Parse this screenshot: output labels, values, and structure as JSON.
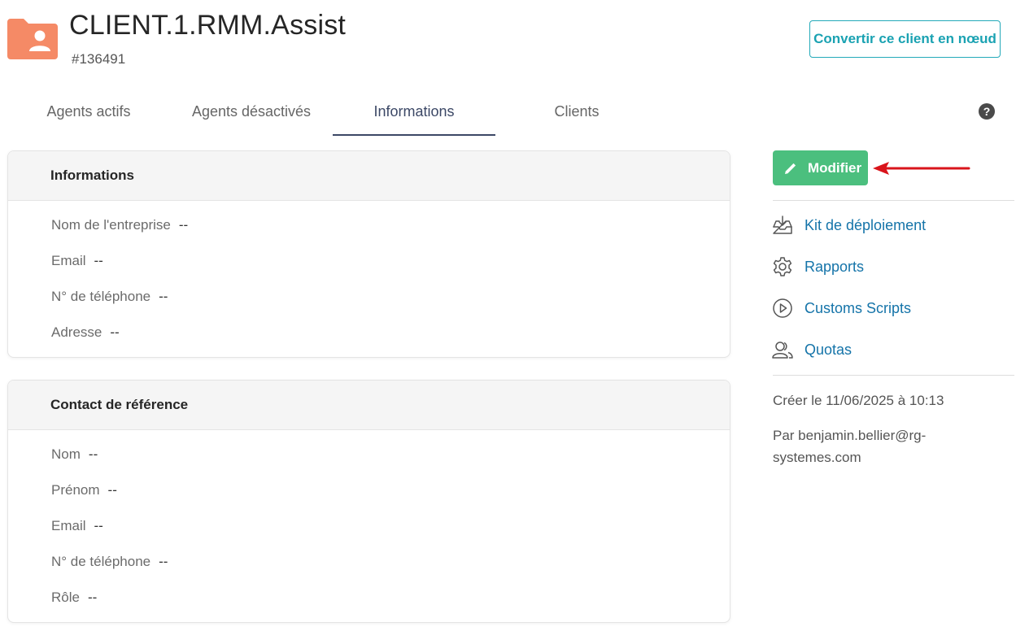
{
  "header": {
    "title": "CLIENT.1.RMM.Assist",
    "id": "#136491",
    "folder_color": "#f58a66",
    "convert_label": "Convertir ce client en nœud"
  },
  "tabs": [
    {
      "label": "Agents actifs"
    },
    {
      "label": "Agents désactivés"
    },
    {
      "label": "Informations"
    },
    {
      "label": "Clients"
    }
  ],
  "active_tab": "Informations",
  "informations_card": {
    "title": "Informations",
    "fields": [
      {
        "label": "Nom de l'entreprise",
        "value": "--"
      },
      {
        "label": "Email",
        "value": "--"
      },
      {
        "label": "N° de téléphone",
        "value": "--"
      },
      {
        "label": "Adresse",
        "value": "--"
      }
    ]
  },
  "contact_card": {
    "title": "Contact de référence",
    "fields": [
      {
        "label": "Nom",
        "value": "--"
      },
      {
        "label": "Prénom",
        "value": "--"
      },
      {
        "label": "Email",
        "value": "--"
      },
      {
        "label": "N° de téléphone",
        "value": "--"
      },
      {
        "label": "Rôle",
        "value": "--"
      }
    ]
  },
  "sidebar": {
    "edit_label": "Modifier",
    "edit_color": "#4bbf7e",
    "annotation_arrow_color": "#d9141b",
    "links": [
      {
        "label": "Kit de déploiement",
        "icon": "inbox-download-icon"
      },
      {
        "label": "Rapports",
        "icon": "gear-icon"
      },
      {
        "label": "Customs Scripts",
        "icon": "play-circle-icon"
      },
      {
        "label": "Quotas",
        "icon": "users-icon"
      }
    ],
    "created": "Créer le 11/06/2025 à 10:13",
    "author_line1": "Par benjamin.bellier@rg-",
    "author_line2": "systemes.com"
  }
}
